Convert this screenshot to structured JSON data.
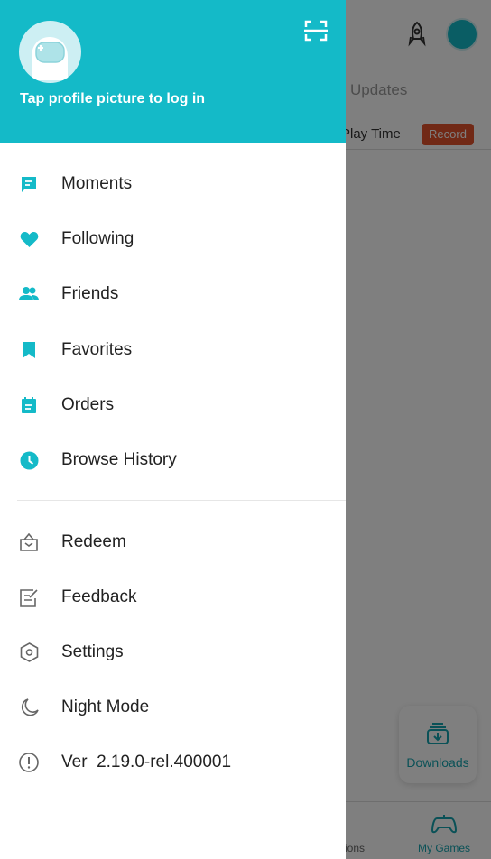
{
  "colors": {
    "accent": "#14bac8",
    "record": "#e2522c"
  },
  "header": {
    "login_text": "Tap profile picture to log in",
    "scan_icon": "scan-icon"
  },
  "menu_primary": [
    {
      "label": "Moments",
      "icon": "chat-icon"
    },
    {
      "label": "Following",
      "icon": "heart-icon"
    },
    {
      "label": "Friends",
      "icon": "people-icon"
    },
    {
      "label": "Favorites",
      "icon": "bookmark-icon"
    },
    {
      "label": "Orders",
      "icon": "clipboard-icon"
    },
    {
      "label": "Browse History",
      "icon": "clock-icon"
    }
  ],
  "menu_secondary": [
    {
      "label": "Redeem",
      "icon": "bag-icon"
    },
    {
      "label": "Feedback",
      "icon": "edit-icon"
    },
    {
      "label": "Settings",
      "icon": "hexagon-gear-icon"
    },
    {
      "label": "Night Mode",
      "icon": "moon-icon"
    },
    {
      "label": "Ver  2.19.0-rel.400001",
      "icon": "info-icon"
    }
  ],
  "background": {
    "tab_updates": "Updates",
    "play_time": "Play Time",
    "record": "Record",
    "downloads": "Downloads",
    "nav_notifications": "ations",
    "nav_my_games": "My Games"
  }
}
